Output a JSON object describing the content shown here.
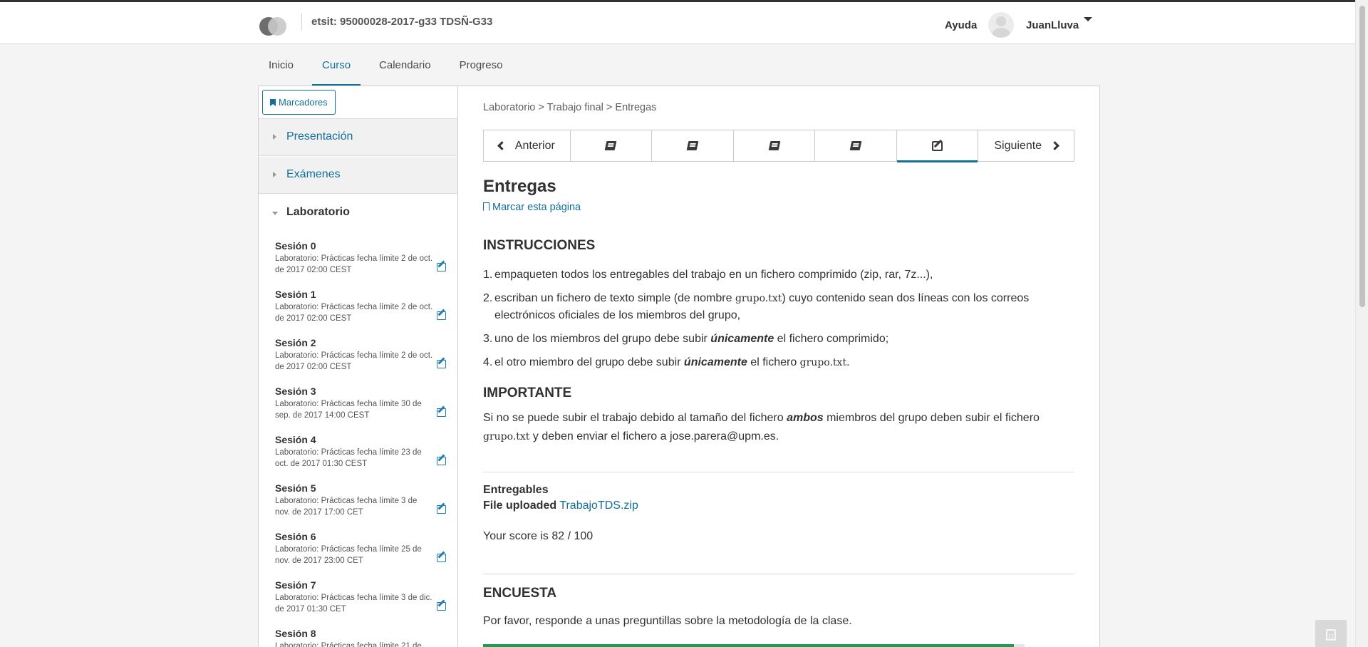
{
  "header": {
    "course_title": "etsit: 95000028-2017-g33 TDSÑ-G33",
    "help_label": "Ayuda",
    "username": "JuanLluva"
  },
  "tabs": [
    {
      "label": "Inicio"
    },
    {
      "label": "Curso"
    },
    {
      "label": "Calendario"
    },
    {
      "label": "Progreso"
    }
  ],
  "sidebar": {
    "bookmarks_label": "Marcadores",
    "sections": [
      {
        "label": "Presentación"
      },
      {
        "label": "Exámenes"
      },
      {
        "label": "Laboratorio"
      }
    ],
    "sessions": [
      {
        "title": "Sesión 0",
        "desc": "Laboratorio: Prácticas fecha límite 2 de oct. de 2017 02:00 CEST"
      },
      {
        "title": "Sesión 1",
        "desc": "Laboratorio: Prácticas fecha límite 2 de oct. de 2017 02:00 CEST"
      },
      {
        "title": "Sesión 2",
        "desc": "Laboratorio: Prácticas fecha límite 2 de oct. de 2017 02:00 CEST"
      },
      {
        "title": "Sesión 3",
        "desc": "Laboratorio: Prácticas fecha límite 30 de sep. de 2017 14:00 CEST"
      },
      {
        "title": "Sesión 4",
        "desc": "Laboratorio: Prácticas fecha límite 23 de oct. de 2017 01:30 CEST"
      },
      {
        "title": "Sesión 5",
        "desc": "Laboratorio: Prácticas fecha límite 3 de nov. de 2017 17:00 CET"
      },
      {
        "title": "Sesión 6",
        "desc": "Laboratorio: Prácticas fecha límite 25 de nov. de 2017 23:00 CET"
      },
      {
        "title": "Sesión 7",
        "desc": "Laboratorio: Prácticas fecha límite 3 de dic. de 2017 01:30 CET"
      },
      {
        "title": "Sesión 8",
        "desc": "Laboratorio: Prácticas fecha límite 21 de"
      }
    ]
  },
  "main": {
    "breadcrumb": "Laboratorio > Trabajo final > Entregas",
    "prev_label": "Anterior",
    "next_label": "Siguiente",
    "unit_title": "Entregas",
    "bookmark_link": "Marcar esta página",
    "instructions_heading": "INSTRUCCIONES",
    "instructions": {
      "i1_num": "1.",
      "i1": "empaqueten todos los entregables del trabajo en un fichero comprimido (zip, rar, 7z...),",
      "i2_num": "2.",
      "i2_a": "escriban un fichero de texto simple (de nombre ",
      "i2_code": "grupo.txt",
      "i2_b": ") cuyo contenido sean dos líneas con los correos electrónicos oficiales de los miembros del grupo,",
      "i3_num": "3.",
      "i3_a": "uno de los miembros del grupo debe subir ",
      "i3_em": "únicamente",
      "i3_b": " el fichero comprimido;",
      "i4_num": "4.",
      "i4_a": "el otro miembro del grupo debe subir ",
      "i4_em": "únicamente",
      "i4_b": " el fichero ",
      "i4_code": "grupo.txt",
      "i4_c": "."
    },
    "important_heading": "IMPORTANTE",
    "important": {
      "a": "Si no se puede subir el trabajo debido al tamaño del fichero ",
      "em": "ambos",
      "b": " miembros del grupo deben subir el fichero ",
      "code": "grupo.txt",
      "c": " y deben enviar el fichero a jose.parera@upm.es."
    },
    "deliverables_label": "Entregables",
    "file_uploaded_label": "File uploaded",
    "file_name": "TrabajoTDS.zip",
    "score_text": "Your score is 82 / 100",
    "survey_heading": "ENCUESTA",
    "survey_text": "Por favor, responde a unas preguntillas sobre la metodología de la clase.",
    "progress_fraction": 0.98
  },
  "icons": {
    "unit_types": [
      "book-icon",
      "book-icon",
      "book-icon",
      "book-icon",
      "edit-icon"
    ]
  },
  "colors": {
    "link": "#126f9a",
    "progress": "#1f9c52"
  }
}
